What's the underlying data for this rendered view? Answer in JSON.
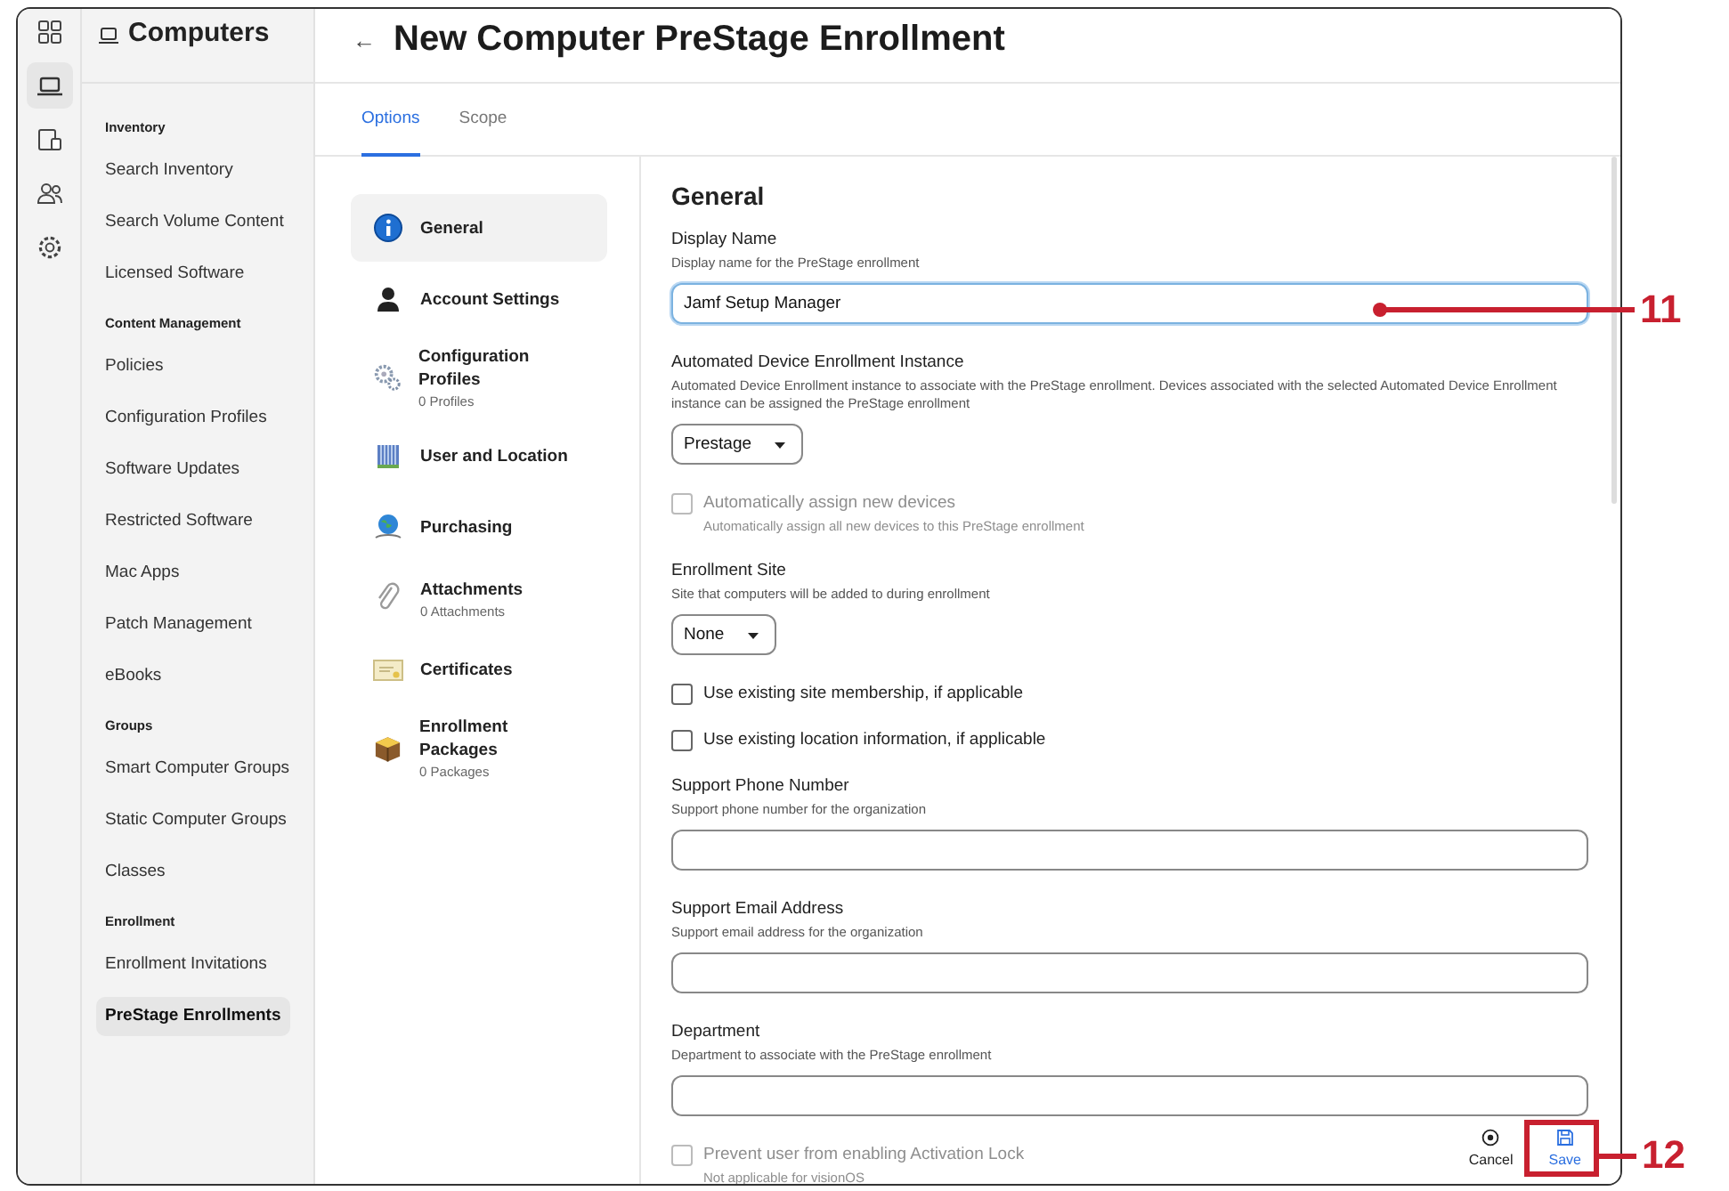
{
  "rail": {
    "items": [
      {
        "kind": "grid",
        "selected": false
      },
      {
        "kind": "laptop",
        "selected": true
      },
      {
        "kind": "devices",
        "selected": false
      },
      {
        "kind": "users",
        "selected": false
      },
      {
        "kind": "gear",
        "selected": false
      }
    ]
  },
  "sidebar": {
    "title": "Computers",
    "sections": [
      {
        "heading": "Inventory",
        "items": [
          {
            "label": "Search Inventory",
            "selected": false
          },
          {
            "label": "Search Volume Content",
            "selected": false
          },
          {
            "label": "Licensed Software",
            "selected": false
          }
        ]
      },
      {
        "heading": "Content Management",
        "items": [
          {
            "label": "Policies",
            "selected": false
          },
          {
            "label": "Configuration Profiles",
            "selected": false
          },
          {
            "label": "Software Updates",
            "selected": false
          },
          {
            "label": "Restricted Software",
            "selected": false
          },
          {
            "label": "Mac Apps",
            "selected": false
          },
          {
            "label": "Patch Management",
            "selected": false
          },
          {
            "label": "eBooks",
            "selected": false
          }
        ]
      },
      {
        "heading": "Groups",
        "items": [
          {
            "label": "Smart Computer Groups",
            "selected": false
          },
          {
            "label": "Static Computer Groups",
            "selected": false
          },
          {
            "label": "Classes",
            "selected": false
          }
        ]
      },
      {
        "heading": "Enrollment",
        "items": [
          {
            "label": "Enrollment Invitations",
            "selected": false
          },
          {
            "label": "PreStage Enrollments",
            "selected": true
          }
        ]
      }
    ]
  },
  "page": {
    "back": "←",
    "title": "New Computer PreStage Enrollment"
  },
  "tabs": [
    {
      "label": "Options",
      "selected": true
    },
    {
      "label": "Scope",
      "selected": false
    }
  ],
  "options_nav": [
    {
      "kind": "info",
      "label": "General",
      "selected": true
    },
    {
      "kind": "person",
      "label": "Account Settings",
      "selected": false
    },
    {
      "kind": "gears",
      "label": "Configuration Profiles",
      "count": "0 Profiles",
      "selected": false
    },
    {
      "kind": "building",
      "label": "User and Location",
      "selected": false
    },
    {
      "kind": "globe",
      "label": "Purchasing",
      "selected": false
    },
    {
      "kind": "paperclip",
      "label": "Attachments",
      "count": "0 Attachments",
      "selected": false
    },
    {
      "kind": "certificate",
      "label": "Certificates",
      "selected": false
    },
    {
      "kind": "package",
      "label": "Enrollment Packages",
      "count": "0 Packages",
      "selected": false
    }
  ],
  "form": {
    "heading": "General",
    "fields": [
      {
        "kind": "text",
        "label": "Display Name",
        "hint": "Display name for the PreStage enrollment",
        "value": "Jamf Setup Manager",
        "focused": true
      },
      {
        "kind": "select",
        "label": "Automated Device Enrollment Instance",
        "hint": "Automated Device Enrollment instance to associate with the PreStage enrollment. Devices associated with the selected Automated Device Enrollment instance can be assigned the PreStage enrollment",
        "value": "Prestage"
      },
      {
        "kind": "checkbox",
        "label": "Automatically assign new devices",
        "hint": "Automatically assign all new devices to this PreStage enrollment",
        "checked": false,
        "disabled": true
      },
      {
        "kind": "select",
        "label": "Enrollment Site",
        "hint": "Site that computers will be added to during enrollment",
        "value": "None"
      },
      {
        "kind": "checkbox",
        "label": "Use existing site membership, if applicable",
        "checked": false,
        "disabled": false
      },
      {
        "kind": "checkbox",
        "label": "Use existing location information, if applicable",
        "checked": false,
        "disabled": false
      },
      {
        "kind": "text",
        "label": "Support Phone Number",
        "hint": "Support phone number for the organization",
        "focused": false
      },
      {
        "kind": "text",
        "label": "Support Email Address",
        "hint": "Support email address for the organization",
        "focused": false
      },
      {
        "kind": "text",
        "label": "Department",
        "hint": "Department to associate with the PreStage enrollment",
        "focused": false
      },
      {
        "kind": "checkbox",
        "label": "Prevent user from enabling Activation Lock",
        "hint": "Not applicable for visionOS",
        "checked": false,
        "disabled": true
      }
    ]
  },
  "footer": {
    "buttons": [
      {
        "kind": "cancel",
        "label": "Cancel"
      },
      {
        "kind": "save",
        "label": "Save"
      }
    ]
  },
  "callouts": [
    {
      "number": "11",
      "kind": "dot"
    },
    {
      "number": "12",
      "kind": "frame"
    }
  ]
}
